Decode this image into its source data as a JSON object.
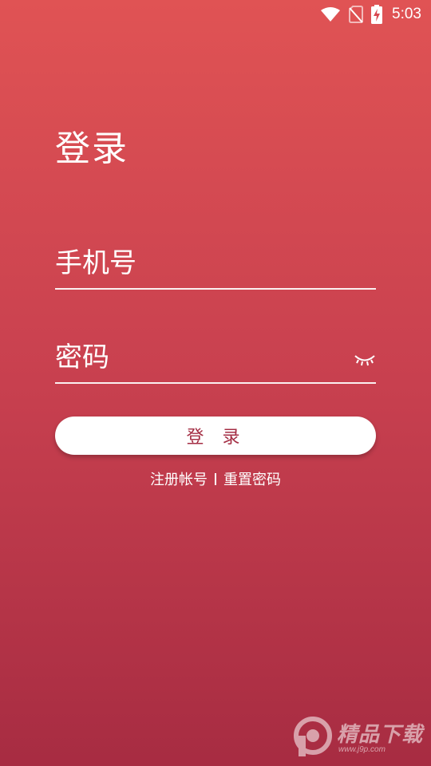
{
  "status_bar": {
    "time": "5:03",
    "icons": [
      "wifi-icon",
      "no-sim-icon",
      "battery-charging-icon"
    ]
  },
  "login": {
    "title": "登录",
    "phone_placeholder": "手机号",
    "password_placeholder": "密码",
    "password_toggle_icon": "eye-closed-icon",
    "submit_label": "登 录"
  },
  "links": {
    "register": "注册帐号",
    "reset_password": "重置密码"
  },
  "watermark": {
    "brand": "精品下载",
    "url": "www.j9p.com"
  },
  "colors": {
    "gradient_top": "#e05354",
    "gradient_bottom": "#a72c42",
    "button_text": "#a42e44"
  }
}
